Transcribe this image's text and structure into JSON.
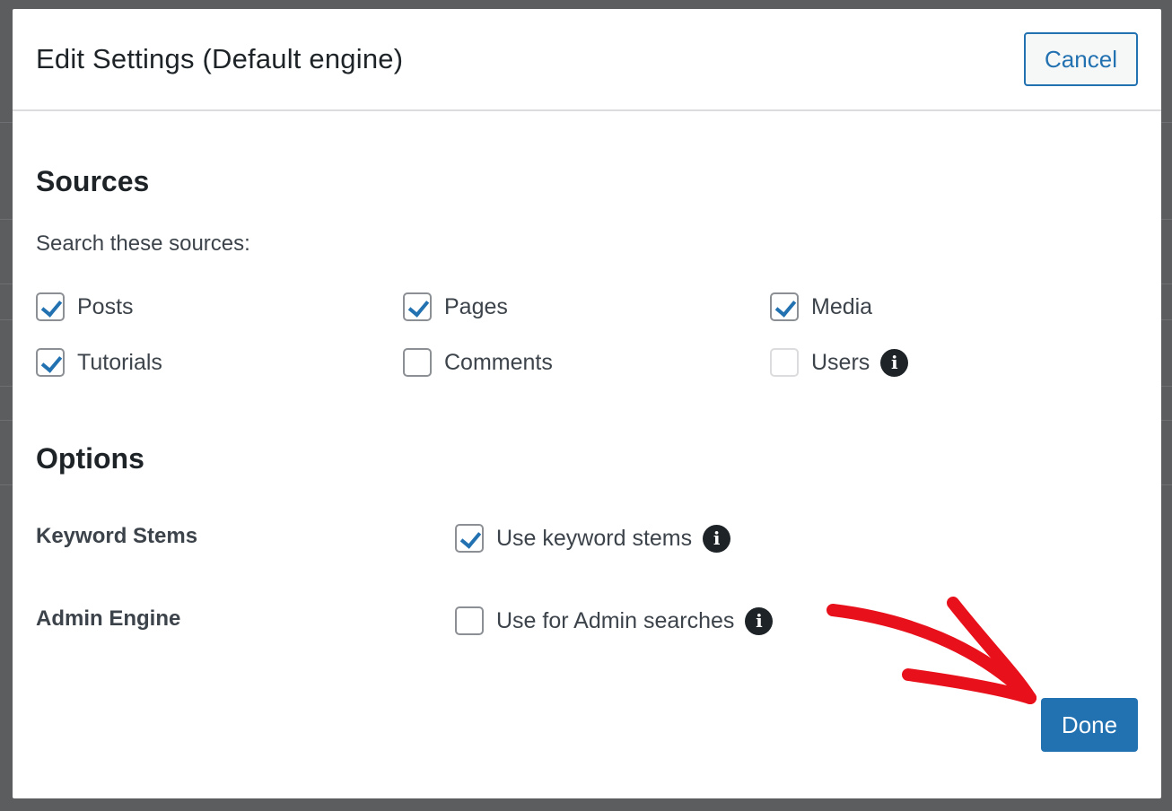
{
  "modal": {
    "title": "Edit Settings (Default engine)",
    "cancel_label": "Cancel",
    "done_label": "Done"
  },
  "sources": {
    "heading": "Sources",
    "sub_label": "Search these sources:",
    "items": [
      {
        "label": "Posts",
        "checked": true
      },
      {
        "label": "Pages",
        "checked": true
      },
      {
        "label": "Media",
        "checked": true
      },
      {
        "label": "Tutorials",
        "checked": true
      },
      {
        "label": "Comments",
        "checked": false
      },
      {
        "label": "Users",
        "checked": false,
        "disabled": true,
        "info_icon": "info-icon"
      }
    ]
  },
  "options": {
    "heading": "Options",
    "rows": [
      {
        "label": "Keyword Stems",
        "checkbox_label": "Use keyword stems",
        "checked": true,
        "info_icon": "info-icon"
      },
      {
        "label": "Admin Engine",
        "checkbox_label": "Use for Admin searches",
        "checked": false,
        "info_icon": "info-icon"
      }
    ]
  },
  "colors": {
    "accent": "#2271b1",
    "annotation_arrow": "#e8111b",
    "overlay": "#5c5d5f"
  }
}
